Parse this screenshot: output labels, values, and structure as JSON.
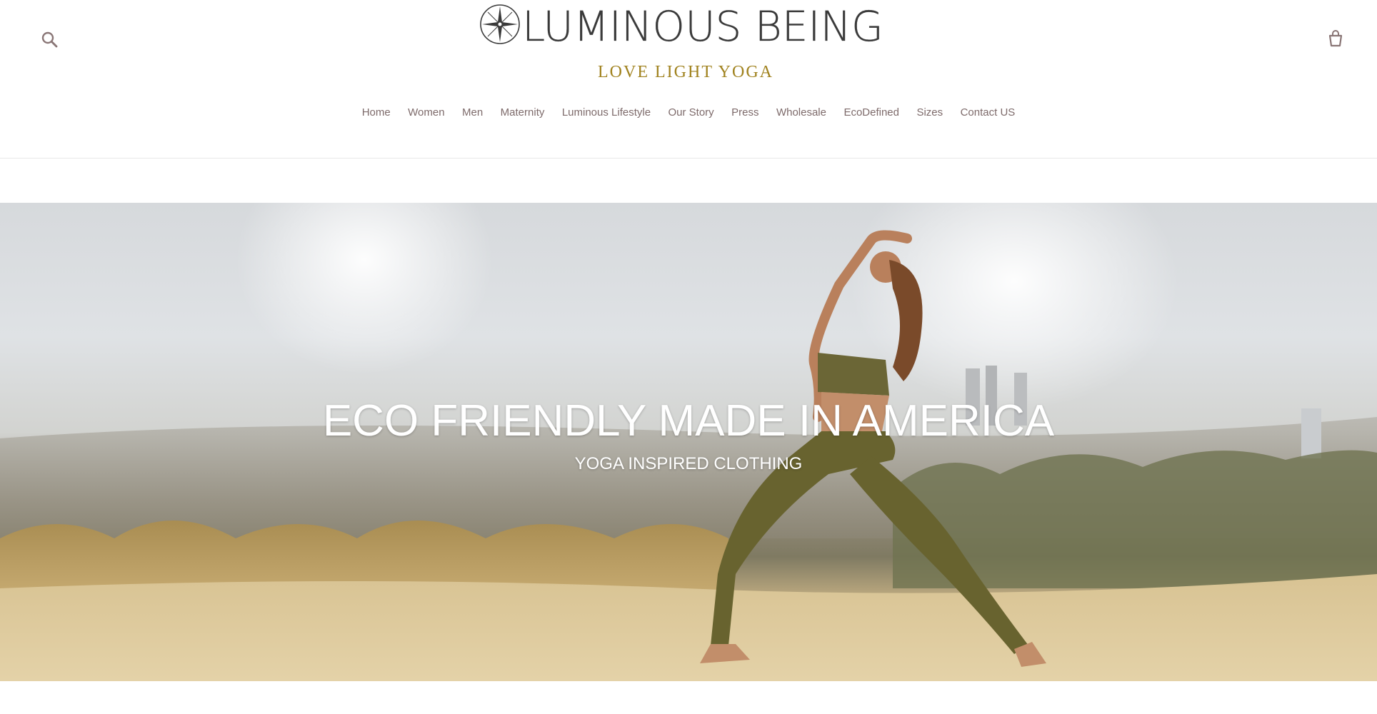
{
  "header": {
    "brand_name": "LUMINOUS BEING",
    "tagline": "LOVE LIGHT YOGA",
    "search_icon": "search-icon",
    "cart_icon": "cart-icon"
  },
  "nav": {
    "items": [
      {
        "label": "Home"
      },
      {
        "label": "Women"
      },
      {
        "label": "Men"
      },
      {
        "label": "Maternity"
      },
      {
        "label": "Luminous Lifestyle"
      },
      {
        "label": "Our Story"
      },
      {
        "label": "Press"
      },
      {
        "label": "Wholesale"
      },
      {
        "label": "EcoDefined"
      },
      {
        "label": "Sizes"
      },
      {
        "label": "Contact US"
      }
    ]
  },
  "hero": {
    "title": "ECO FRIENDLY MADE IN AMERICA",
    "subtitle": "YOGA INSPIRED CLOTHING"
  },
  "colors": {
    "nav_text": "#7d6a6a",
    "tagline_gold": "#a0821e",
    "logo_dark": "#3a3a3a",
    "hero_text": "#ffffff"
  }
}
